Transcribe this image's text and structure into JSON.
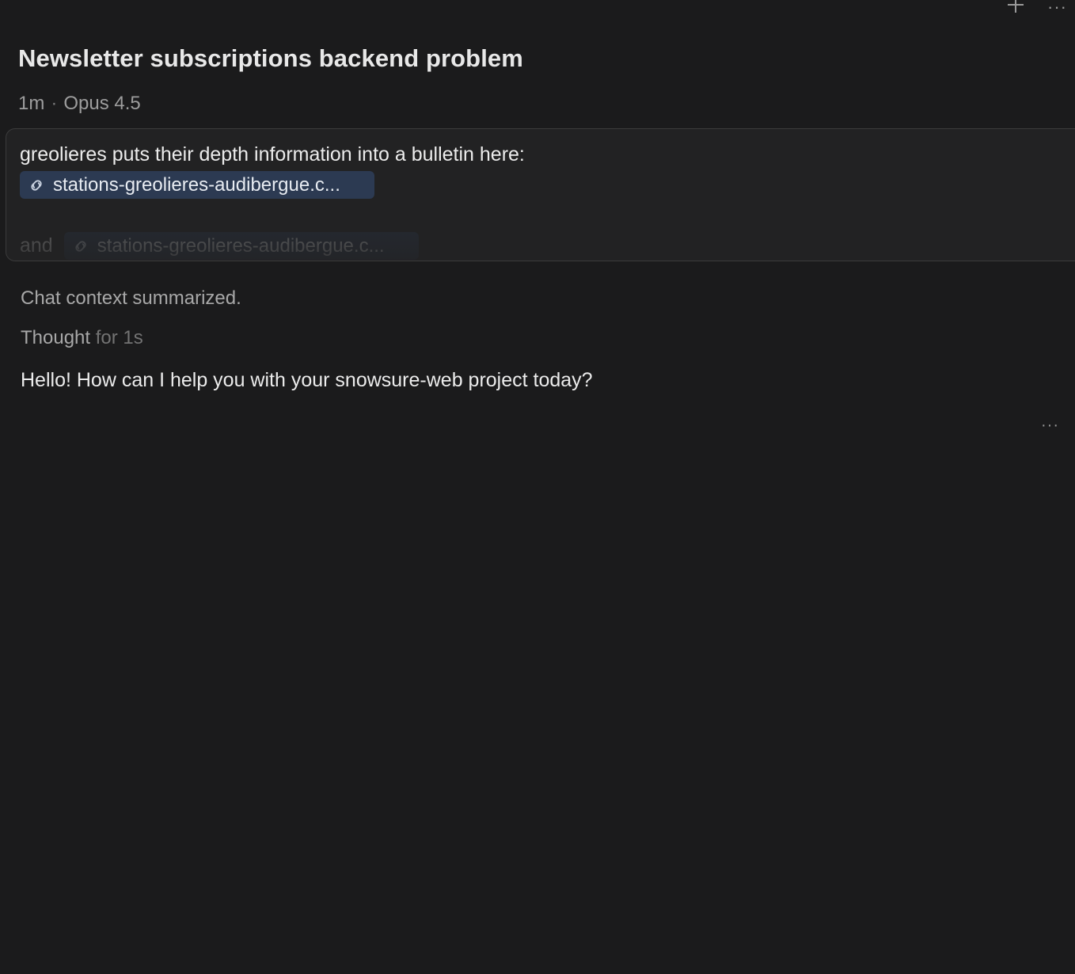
{
  "header": {
    "new_icon": "plus-icon",
    "more_icon": "ellipsis-icon",
    "new_label": "+",
    "more_label": "···"
  },
  "conversation": {
    "title": "Newsletter subscriptions backend problem",
    "meta": {
      "age": "1m",
      "separator": "·",
      "model": "Opus 4.5"
    }
  },
  "user_message": {
    "text": "greolieres puts their depth information into a bulletin here:",
    "link_chip_1": "stations-greolieres-audibergue.c...",
    "connector": "and",
    "link_chip_2": "stations-greolieres-audibergue.c...",
    "link_icon": "link-icon"
  },
  "assistant": {
    "context_status": "Chat context summarized.",
    "thought_label": "Thought",
    "thought_duration": "for 1s",
    "reply": "Hello! How can I help you with your snowsure-web project today?",
    "more_label": "···"
  },
  "colors": {
    "background": "#1b1b1c",
    "prompt_box": "#222223",
    "chip": "#2c3a52",
    "text_primary": "#ececec",
    "text_secondary": "#9d9d9d"
  }
}
